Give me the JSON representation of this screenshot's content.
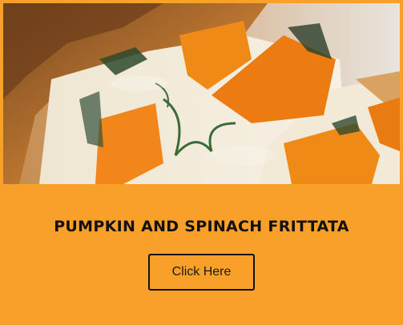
{
  "card": {
    "background_color": "#f9a02a",
    "image_alt": "pumpkin-spinach-frittata-photo",
    "title": "PUMPKIN AND SPINACH FRITTATA",
    "button_label": "Click Here"
  }
}
